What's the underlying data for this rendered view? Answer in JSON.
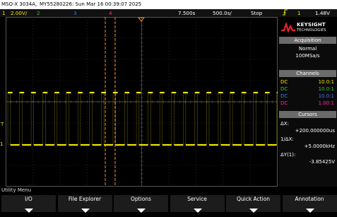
{
  "title_bar": {
    "model": "MSO-X 3034A,",
    "serial_date": "MY55280226: Sun Mar 16 00:39:07 2025"
  },
  "status_bar": {
    "ch1_num": "1",
    "ch1_scale": "2.00V/",
    "ch2_num": "2",
    "ch3_num": "3",
    "ch4_num": "4",
    "delay": "7.500s",
    "timebase": "500.0s/",
    "run_state": "Stop",
    "trig_edge_icon": "rising-edge-icon",
    "trig_channel": "1",
    "trig_level": "1.48V"
  },
  "brand": {
    "name": "KEYSIGHT",
    "sub": "TECHNOLOGIES"
  },
  "acquisition": {
    "header": "Acquisition",
    "mode": "Normal",
    "rate": "100MSa/s"
  },
  "channels": {
    "header": "Channels",
    "rows": [
      {
        "coupling": "DC",
        "probe": "10.0:1",
        "color": "#f2e600"
      },
      {
        "coupling": "DC",
        "probe": "10.0:1",
        "color": "#38c838"
      },
      {
        "coupling": "DC",
        "probe": "10.0:1",
        "color": "#4a73ff"
      },
      {
        "coupling": "DC",
        "probe": "1.00:1",
        "color": "#ff2a9a"
      }
    ]
  },
  "cursors": {
    "header": "Cursors",
    "dx_label": "ΔX:",
    "dx_value": "+200.000000us",
    "inv_dx_label": "1/ΔX:",
    "inv_dx_value": "+5.0000kHz",
    "dy_label": "ΔY(1):",
    "dy_value": "-3.85425V"
  },
  "markers": {
    "trigger_level": "T",
    "ch1_ground": "1"
  },
  "utility_menu": "Utility Menu",
  "softkeys": [
    "I/O",
    "File Explorer",
    "Options",
    "Service",
    "Quick Action",
    "Annotation"
  ],
  "colors": {
    "ch1": "#f2e600",
    "ch2": "#38c838",
    "ch3": "#4a73ff",
    "ch4": "#ff2a9a",
    "cursor": "#ff8c1a",
    "grid": "#3a3a3a"
  }
}
